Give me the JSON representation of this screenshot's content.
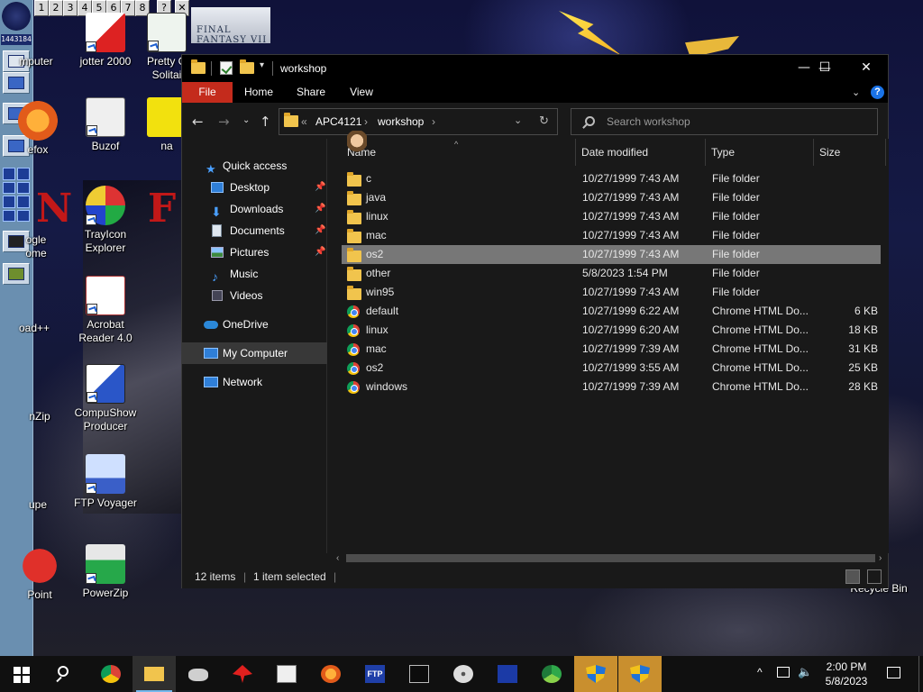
{
  "desktop": {
    "top_strip": [
      "1",
      "2",
      "3",
      "4",
      "5",
      "6",
      "7",
      "8",
      "?",
      "✕"
    ],
    "left_bar_counter": "1443184",
    "wallpaper_logo_text": "FINAL FANTASY VII",
    "icons": [
      {
        "label": "mputer"
      },
      {
        "label": "jotter 2000"
      },
      {
        "label": "Pretty G\nSolitai"
      },
      {
        "label": "efox"
      },
      {
        "label": "Buzof"
      },
      {
        "label": "na"
      },
      {
        "label": "ogle\nome"
      },
      {
        "label": "TrayIcon\nExplorer"
      },
      {
        "label": "oad++"
      },
      {
        "label": "Acrobat\nReader 4.0"
      },
      {
        "label": "nZip"
      },
      {
        "label": "CompuShow\nProducer"
      },
      {
        "label": "upe"
      },
      {
        "label": "FTP Voyager"
      },
      {
        "label": "Point"
      },
      {
        "label": "PowerZip"
      },
      {
        "label": "Recycle Bin"
      }
    ]
  },
  "window": {
    "title": "workshop",
    "controls": {
      "minimize": "—",
      "maximize": "☐",
      "close": "✕"
    },
    "ribbon_tabs": [
      "File",
      "Home",
      "Share",
      "View"
    ],
    "address": {
      "overflow": "«",
      "crumbs": [
        "APC4121",
        "workshop"
      ],
      "separator": "›"
    },
    "search_placeholder": "Search workshop",
    "nav_pane": [
      {
        "label": "Quick access",
        "icon": "star-icon",
        "pinned": false
      },
      {
        "label": "Desktop",
        "icon": "desktop-icon",
        "pinned": true
      },
      {
        "label": "Downloads",
        "icon": "download-icon",
        "pinned": true
      },
      {
        "label": "Documents",
        "icon": "documents-icon",
        "pinned": true
      },
      {
        "label": "Pictures",
        "icon": "pictures-icon",
        "pinned": true
      },
      {
        "label": "Music",
        "icon": "music-icon",
        "pinned": false
      },
      {
        "label": "Videos",
        "icon": "videos-icon",
        "pinned": false
      },
      {
        "label": "OneDrive",
        "icon": "cloud-icon",
        "pinned": false
      },
      {
        "label": "My Computer",
        "icon": "computer-icon",
        "pinned": false,
        "selected": true
      },
      {
        "label": "Network",
        "icon": "network-icon",
        "pinned": false
      }
    ],
    "columns": [
      "Name",
      "Date modified",
      "Type",
      "Size"
    ],
    "files": [
      {
        "name": "c",
        "date": "10/27/1999 7:43 AM",
        "type": "File folder",
        "size": "",
        "kind": "folder"
      },
      {
        "name": "java",
        "date": "10/27/1999 7:43 AM",
        "type": "File folder",
        "size": "",
        "kind": "folder"
      },
      {
        "name": "linux",
        "date": "10/27/1999 7:43 AM",
        "type": "File folder",
        "size": "",
        "kind": "folder"
      },
      {
        "name": "mac",
        "date": "10/27/1999 7:43 AM",
        "type": "File folder",
        "size": "",
        "kind": "folder"
      },
      {
        "name": "os2",
        "date": "10/27/1999 7:43 AM",
        "type": "File folder",
        "size": "",
        "kind": "folder",
        "selected": true
      },
      {
        "name": "other",
        "date": "5/8/2023 1:54 PM",
        "type": "File folder",
        "size": "",
        "kind": "folder"
      },
      {
        "name": "win95",
        "date": "10/27/1999 7:43 AM",
        "type": "File folder",
        "size": "",
        "kind": "folder"
      },
      {
        "name": "default",
        "date": "10/27/1999 6:22 AM",
        "type": "Chrome HTML Do...",
        "size": "6 KB",
        "kind": "chrome"
      },
      {
        "name": "linux",
        "date": "10/27/1999 6:20 AM",
        "type": "Chrome HTML Do...",
        "size": "18 KB",
        "kind": "chrome"
      },
      {
        "name": "mac",
        "date": "10/27/1999 7:39 AM",
        "type": "Chrome HTML Do...",
        "size": "31 KB",
        "kind": "chrome"
      },
      {
        "name": "os2",
        "date": "10/27/1999 3:55 AM",
        "type": "Chrome HTML Do...",
        "size": "25 KB",
        "kind": "chrome"
      },
      {
        "name": "windows",
        "date": "10/27/1999 7:39 AM",
        "type": "Chrome HTML Do...",
        "size": "28 KB",
        "kind": "chrome"
      }
    ],
    "status": {
      "count": "12 items",
      "selection": "1 item selected"
    }
  },
  "taskbar": {
    "apps": [
      "start-icon",
      "search-icon",
      "chrome-icon",
      "file-explorer-icon",
      "drive-icon",
      "rocket-icon",
      "buzof-icon",
      "firefox-icon",
      "ftp-icon",
      "terminal-icon",
      "cd-icon",
      "network-star-icon",
      "recycle-icon",
      "shield-icon",
      "shield-icon"
    ],
    "clock_time": "2:00 PM",
    "clock_date": "5/8/2023",
    "colors": {
      "accent": "#76b9ed",
      "active_app": "#c98f2e"
    }
  },
  "colors": {
    "file_tab": "#c42b1c",
    "folder": "#f1c44d",
    "selection": "#777777",
    "window_bg": "#191919"
  }
}
